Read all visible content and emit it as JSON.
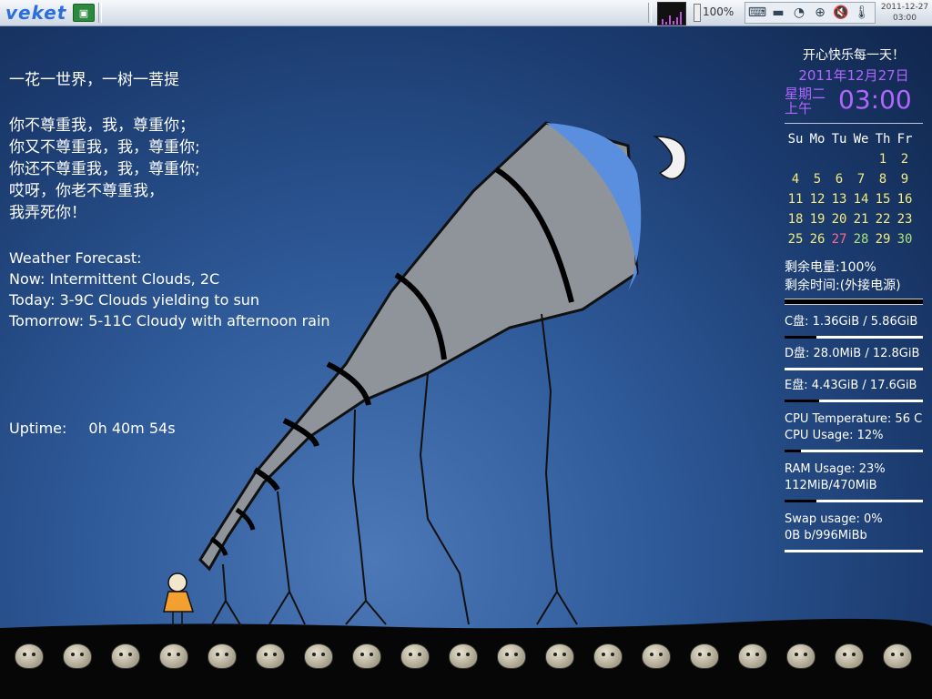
{
  "panel": {
    "logo": "veket",
    "battery_pct": "100%",
    "clock_date": "2011-12-27",
    "clock_time": "03:00",
    "tray_icons": [
      "keyboard-icon",
      "printer-icon",
      "clock-icon",
      "network-icon",
      "volume-muted-icon",
      "thermometer-icon"
    ]
  },
  "left": {
    "line1": "一花一世界，一树一菩提",
    "poem": [
      "你不尊重我，我，尊重你；",
      "你又不尊重我，我，尊重你;",
      "你还不尊重我，我，尊重你;",
      "哎呀，你老不尊重我，",
      "我弄死你！"
    ],
    "weather_title": "Weather Forecast:",
    "weather_now": "Now: Intermittent Clouds, 2C",
    "weather_today": "Today: 3-9C Clouds yielding to sun",
    "weather_tomorrow": "Tomorrow: 5-11C Cloudy with afternoon rain",
    "uptime_label": "Uptime:",
    "uptime_value": "0h 40m 54s"
  },
  "right": {
    "motto": "开心快乐每一天！",
    "date": "2011年12月27日",
    "weekday": "星期二",
    "ampm": "上午",
    "time": "03:00",
    "cal_head": [
      "Su",
      "Mo",
      "Tu",
      "We",
      "Th",
      "Fr"
    ],
    "cal_rows": [
      [
        "",
        "",
        "",
        "",
        "1",
        "2"
      ],
      [
        "4",
        "5",
        "6",
        "7",
        "8",
        "9"
      ],
      [
        "11",
        "12",
        "13",
        "14",
        "15",
        "16"
      ],
      [
        "18",
        "19",
        "20",
        "21",
        "22",
        "23"
      ],
      [
        "25",
        "26",
        "27",
        "28",
        "29",
        "30"
      ]
    ],
    "battery_remaining": "剩余电量:100%",
    "time_remaining": "剩余时间:(外接电源)",
    "disk_c": "C盘:    1.36GiB / 5.86GiB",
    "disk_d": "D盘:   28.0MiB / 12.8GiB",
    "disk_e": "E盘:    4.43GiB / 17.6GiB",
    "cpu_temp": "CPU Temperature: 56 C",
    "cpu_usage": "CPU Usage: 12%",
    "ram_usage": "RAM Usage: 23%",
    "ram_detail": "112MiB/470MiB",
    "swap_usage": "Swap usage: 0%",
    "swap_detail": "0B  b/996MiBb",
    "levels": {
      "battery": 1.0,
      "disk_c": 0.23,
      "disk_d": 0.0,
      "disk_e": 0.25,
      "cpu": 0.12,
      "ram": 0.23,
      "swap": 0.0
    }
  },
  "colors": {
    "accent": "#b065ff",
    "calendar_day": "#f4ec7a",
    "calendar_today": "#ff6a8a"
  }
}
